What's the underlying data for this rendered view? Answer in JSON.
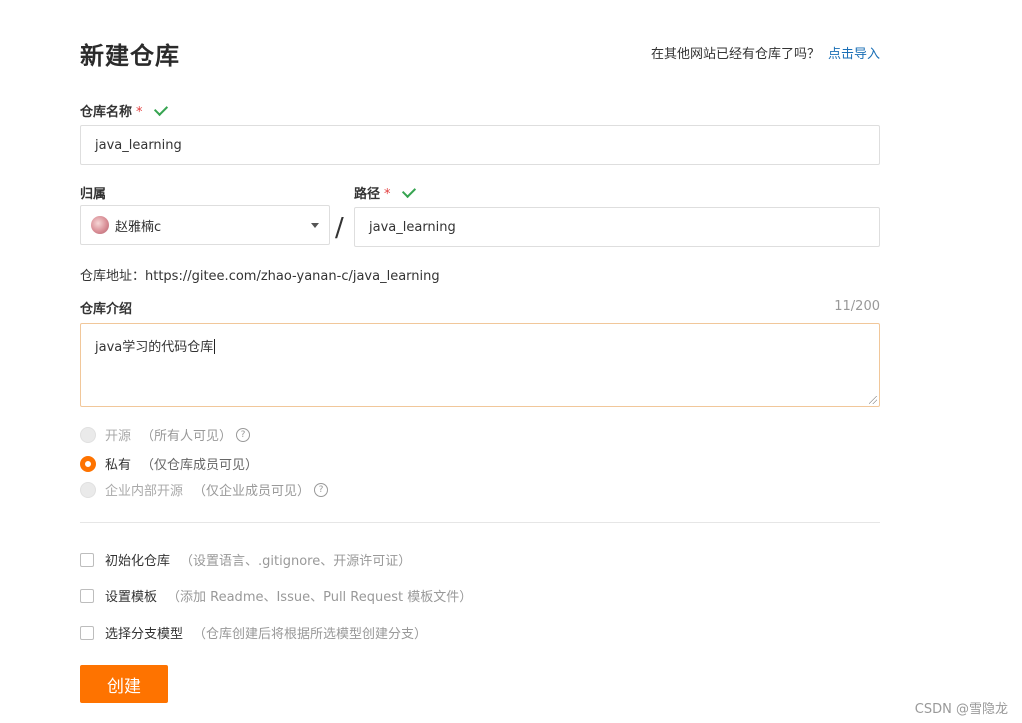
{
  "header": {
    "title": "新建仓库",
    "import_question": "在其他网站已经有仓库了吗？",
    "import_link": "点击导入"
  },
  "repo_name": {
    "label": "仓库名称",
    "required_mark": "*",
    "value": "java_learning"
  },
  "owner": {
    "label": "归属",
    "selected": "赵雅楠c"
  },
  "separator": "/",
  "path": {
    "label": "路径",
    "required_mark": "*",
    "value": "java_learning"
  },
  "address": {
    "text": "仓库地址：https://gitee.com/zhao-yanan-c/java_learning"
  },
  "description": {
    "label": "仓库介绍",
    "counter": "11/200",
    "value": "java学习的代码仓库"
  },
  "visibility": {
    "options": [
      {
        "label": "开源",
        "hint": "（所有人可见）",
        "state": "disabled"
      },
      {
        "label": "私有",
        "hint": "（仅仓库成员可见）",
        "state": "selected"
      },
      {
        "label": "企业内部开源",
        "hint": "（仅企业成员可见）",
        "state": "disabled"
      }
    ]
  },
  "options": [
    {
      "label": "初始化仓库",
      "hint": "（设置语言、.gitignore、开源许可证）",
      "checked": false
    },
    {
      "label": "设置模板",
      "hint": "（添加 Readme、Issue、Pull Request 模板文件）",
      "checked": false
    },
    {
      "label": "选择分支模型",
      "hint": "（仓库创建后将根据所选模型创建分支）",
      "checked": false
    }
  ],
  "submit": {
    "label": "创建"
  },
  "watermark": "CSDN @雪隐龙",
  "colors": {
    "accent": "#fe7300",
    "link": "#1a6fb6",
    "valid": "#37a451",
    "required": "#e23d3d"
  }
}
